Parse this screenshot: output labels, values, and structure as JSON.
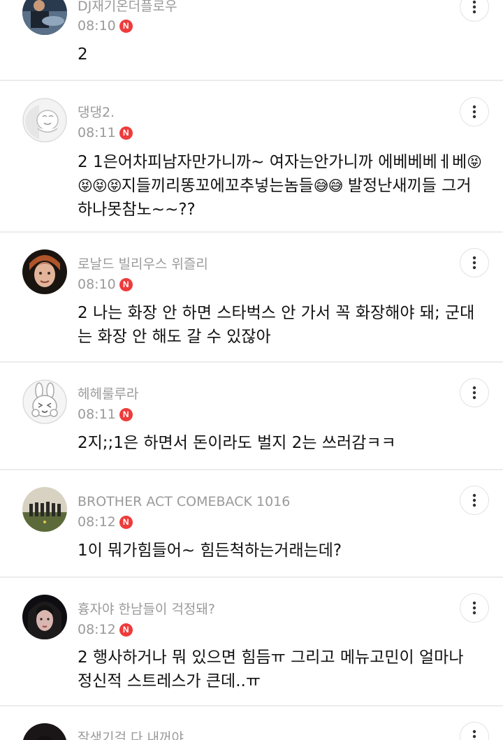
{
  "comments": [
    {
      "author": "DJ재기온더플로우",
      "time": "08:10",
      "badge": "N",
      "text": "2"
    },
    {
      "author": "댕댕2.",
      "time": "08:11",
      "badge": "N",
      "text_a": "2 1은어차피남자만가니까~ 여자는안가니까 에베베베ㅔ베",
      "emoji_a": "😝😝😝😝",
      "text_b": "지들끼리똥꼬에꼬추넣는놈들",
      "emoji_b": "😅😅",
      "text_c": " 발정난새끼들 그거하나못참노~~??"
    },
    {
      "author": "로날드 빌리우스 위즐리",
      "time": "08:10",
      "badge": "N",
      "text": "2 나는 화장 안 하면 스타벅스 안 가서 꼭 화장해야 돼; 군대는 화장 안 해도 갈 수 있잖아"
    },
    {
      "author": "헤헤룰루라",
      "time": "08:11",
      "badge": "N",
      "text": "2지;;1은 하면서 돈이라도 벌지 2는 쓰러감ㅋㅋ"
    },
    {
      "author": "BROTHER ACT COMEBACK 1016",
      "time": "08:12",
      "badge": "N",
      "text": "1이 뭐가힘들어~ 힘든척하는거래는데?"
    },
    {
      "author": "흉자야 한남들이 걱정돼?",
      "time": "08:12",
      "badge": "N",
      "text": "2 행사하거나 뭐 있으면 힘듬ㅠ 그리고 메뉴고민이 얼마나 정신적 스트레스가 큰데..ㅠ"
    },
    {
      "author": "잘생기걸 다 내꺼야"
    }
  ]
}
